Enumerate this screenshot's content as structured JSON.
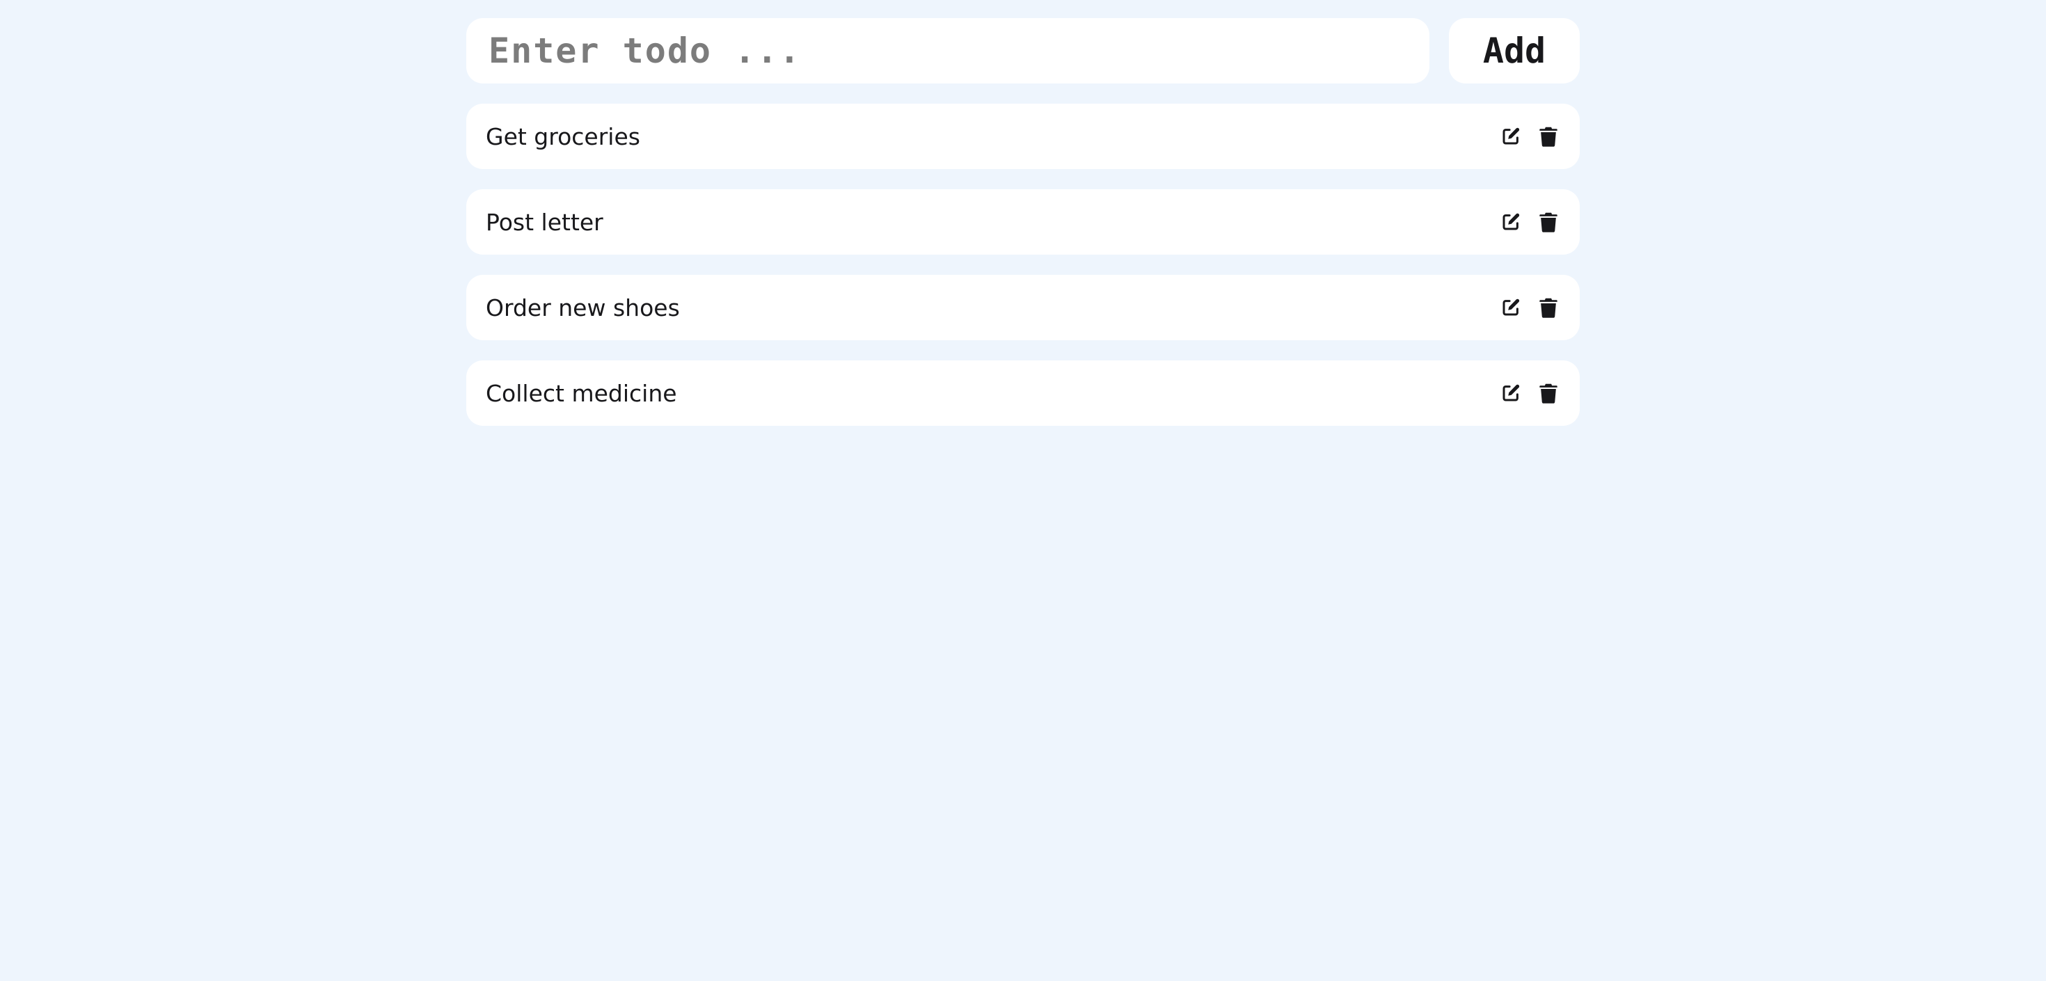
{
  "input": {
    "placeholder": "Enter todo ...",
    "value": ""
  },
  "add_button": {
    "label": "Add"
  },
  "todos": [
    {
      "text": "Get groceries"
    },
    {
      "text": "Post letter"
    },
    {
      "text": "Order new shoes"
    },
    {
      "text": "Collect medicine"
    }
  ],
  "icons": {
    "edit": "edit-icon",
    "delete": "trash-icon"
  },
  "colors": {
    "background": "#eef5fd",
    "card": "#ffffff",
    "text": "#18181b",
    "placeholder": "#7c7c7c"
  }
}
